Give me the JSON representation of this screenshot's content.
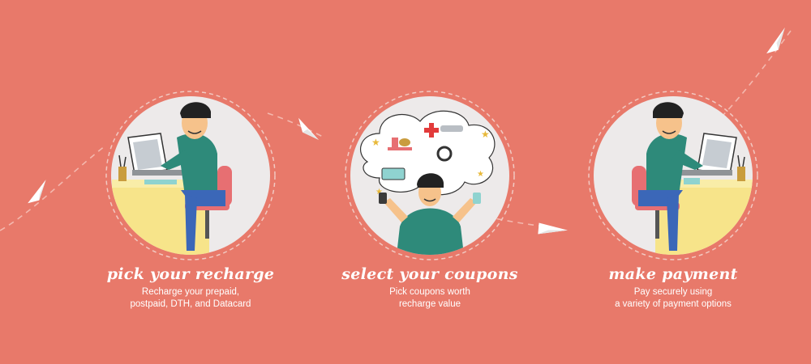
{
  "colors": {
    "background": "#E8796A",
    "circle_fill": "#EDEAEA",
    "circle_ring": "#F2C9C2",
    "text": "#FFFFFF"
  },
  "steps": [
    {
      "title": "pick your recharge",
      "desc_line1": "Recharge your prepaid,",
      "desc_line2": "postpaid, DTH, and Datacard",
      "illustration": "person-at-laptop"
    },
    {
      "title": "select your coupons",
      "desc_line1": "Pick coupons worth",
      "desc_line2": "recharge value",
      "illustration": "person-thinking-of-coupons"
    },
    {
      "title": "make payment",
      "desc_line1": "Pay securely using",
      "desc_line2": "a variety of payment options",
      "illustration": "person-paying-with-card"
    }
  ],
  "decorations": {
    "path_icon": "paper-plane-icon",
    "path_style": "dashed"
  }
}
